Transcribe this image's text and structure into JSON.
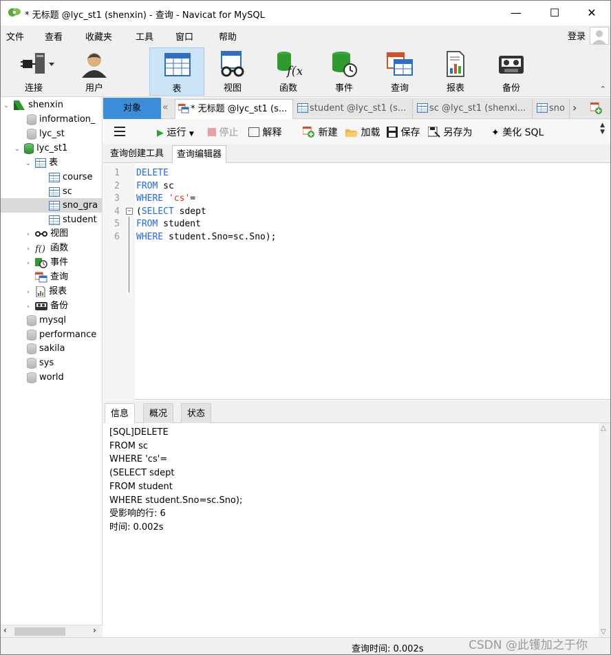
{
  "window": {
    "title": "* 无标题 @lyc_st1 (shenxin) - 查询 - Navicat for MySQL"
  },
  "menu": {
    "items": [
      "文件",
      "查看",
      "收藏夹",
      "工具",
      "窗口",
      "帮助"
    ],
    "login": "登录"
  },
  "toolbar": {
    "items": [
      {
        "label": "连接",
        "icon": "plug-icon"
      },
      {
        "label": "用户",
        "icon": "user-icon"
      },
      {
        "label": "表",
        "icon": "table-icon",
        "active": true
      },
      {
        "label": "视图",
        "icon": "glasses-icon"
      },
      {
        "label": "函数",
        "icon": "function-icon"
      },
      {
        "label": "事件",
        "icon": "event-icon"
      },
      {
        "label": "查询",
        "icon": "query-icon"
      },
      {
        "label": "报表",
        "icon": "report-icon"
      },
      {
        "label": "备份",
        "icon": "backup-icon"
      }
    ]
  },
  "tree": {
    "nodes": [
      {
        "label": "shenxin",
        "type": "connection",
        "expanded": true
      },
      {
        "label": "information_",
        "type": "db"
      },
      {
        "label": "lyc_st",
        "type": "db"
      },
      {
        "label": "lyc_st1",
        "type": "db-open",
        "expanded": true
      },
      {
        "label": "表",
        "type": "folder-table",
        "expanded": true
      },
      {
        "label": "course",
        "type": "table"
      },
      {
        "label": "sc",
        "type": "table"
      },
      {
        "label": "sno_gra",
        "type": "table",
        "selected": true
      },
      {
        "label": "student",
        "type": "table"
      },
      {
        "label": "视图",
        "type": "folder-view"
      },
      {
        "label": "函数",
        "type": "folder-func"
      },
      {
        "label": "事件",
        "type": "folder-event"
      },
      {
        "label": "查询",
        "type": "folder-query"
      },
      {
        "label": "报表",
        "type": "folder-report"
      },
      {
        "label": "备份",
        "type": "folder-backup"
      },
      {
        "label": "mysql",
        "type": "db"
      },
      {
        "label": "performance",
        "type": "db"
      },
      {
        "label": "sakila",
        "type": "db"
      },
      {
        "label": "sys",
        "type": "db"
      },
      {
        "label": "world",
        "type": "db"
      }
    ]
  },
  "tabs": {
    "object_tab": "对象",
    "docs": [
      {
        "label": "* 无标题 @lyc_st1 (s...",
        "active": true
      },
      {
        "label": "student @lyc_st1 (s..."
      },
      {
        "label": "sc @lyc_st1 (shenxi..."
      },
      {
        "label": "sno"
      }
    ]
  },
  "query_toolbar": {
    "run": "运行",
    "stop": "停止",
    "explain": "解释",
    "new": "新建",
    "load": "加载",
    "save": "保存",
    "save_as": "另存为",
    "beautify": "美化 SQL"
  },
  "subtabs": [
    "查询创建工具",
    "查询编辑器"
  ],
  "editor": {
    "lines": [
      {
        "num": "1",
        "parts": [
          {
            "t": "DELETE",
            "c": "kw"
          }
        ]
      },
      {
        "num": "2",
        "parts": [
          {
            "t": "FROM",
            "c": "kw"
          },
          {
            "t": " sc",
            "c": ""
          }
        ]
      },
      {
        "num": "3",
        "parts": [
          {
            "t": "WHERE",
            "c": "kw"
          },
          {
            "t": " ",
            "c": ""
          },
          {
            "t": "'cs'",
            "c": "str"
          },
          {
            "t": "=",
            "c": ""
          }
        ]
      },
      {
        "num": "4",
        "parts": [
          {
            "t": "(",
            "c": ""
          },
          {
            "t": "SELECT",
            "c": "kw"
          },
          {
            "t": " sdept",
            "c": ""
          }
        ]
      },
      {
        "num": "5",
        "parts": [
          {
            "t": "FROM",
            "c": "kw"
          },
          {
            "t": " student",
            "c": ""
          }
        ]
      },
      {
        "num": "6",
        "parts": [
          {
            "t": "WHERE",
            "c": "kw"
          },
          {
            "t": " student.Sno=sc.Sno);",
            "c": ""
          }
        ]
      }
    ]
  },
  "bottom_tabs": [
    "信息",
    "概况",
    "状态"
  ],
  "info": {
    "lines": [
      "[SQL]DELETE",
      "FROM sc",
      "WHERE 'cs'=",
      "(SELECT sdept",
      "FROM student",
      "WHERE student.Sno=sc.Sno);",
      "受影响的行: 6",
      "时间: 0.002s"
    ]
  },
  "status": {
    "query_time": "查询时间: 0.002s"
  },
  "watermark": "CSDN @此镬加之于你",
  "colors": {
    "accent_tab": "#3a8ed9",
    "active_tool": "#cce4f7",
    "keyword": "#1e66ff",
    "string": "#c8322a"
  }
}
